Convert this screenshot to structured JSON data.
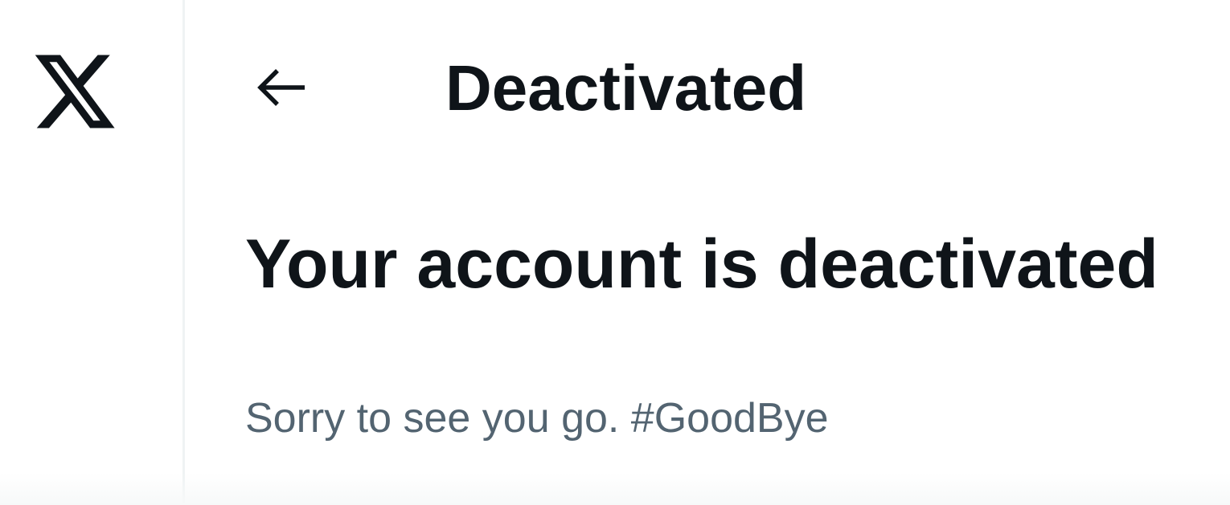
{
  "sidebar": {
    "logo_icon": "x-logo-icon"
  },
  "header": {
    "back_icon": "arrow-left-icon",
    "title": "Deactivated"
  },
  "main": {
    "headline": "Your account is deactivated",
    "message": "Sorry to see you go. #GoodBye"
  },
  "colors": {
    "primary_text": "#0f1419",
    "secondary_text": "#536471",
    "divider": "#eff3f4",
    "background": "#ffffff"
  }
}
